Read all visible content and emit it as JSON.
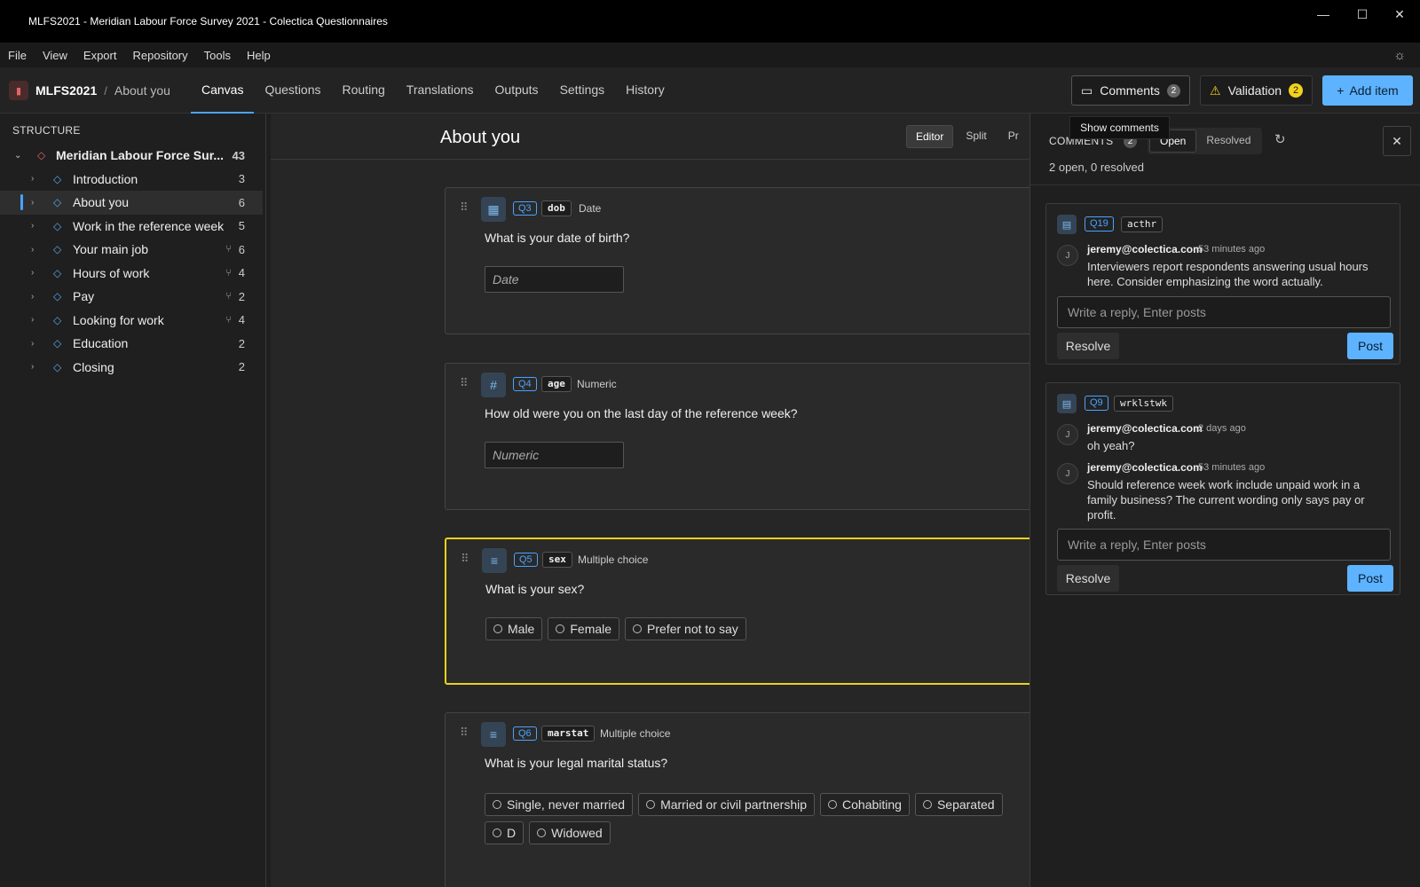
{
  "window": {
    "title": "MLFS2021 - Meridian Labour Force Survey 2021 - Colectica Questionnaires",
    "controls": {
      "minimize": "—",
      "maximize": "☐",
      "close": "✕"
    }
  },
  "menu": [
    "File",
    "View",
    "Export",
    "Repository",
    "Tools",
    "Help"
  ],
  "toolbar": {
    "project": "MLFS2021",
    "separator": "/",
    "page": "About you",
    "tabs": [
      "Canvas",
      "Questions",
      "Routing",
      "Translations",
      "Outputs",
      "Settings",
      "History"
    ],
    "active_tab": "Canvas",
    "comments_label": "Comments",
    "comments_count": "2",
    "validation_label": "Validation",
    "validation_count": "2",
    "add_item_label": "Add item",
    "tooltip": "Show comments"
  },
  "sidebar": {
    "heading": "STRUCTURE",
    "root": {
      "label": "Meridian Labour Force Sur...",
      "count": "43"
    },
    "items": [
      {
        "label": "Introduction",
        "count": "3",
        "branch": false
      },
      {
        "label": "About you",
        "count": "6",
        "branch": false,
        "selected": true
      },
      {
        "label": "Work in the reference week",
        "count": "5",
        "branch": false
      },
      {
        "label": "Your main job",
        "count": "6",
        "branch": true
      },
      {
        "label": "Hours of work",
        "count": "4",
        "branch": true
      },
      {
        "label": "Pay",
        "count": "2",
        "branch": true
      },
      {
        "label": "Looking for work",
        "count": "4",
        "branch": true
      },
      {
        "label": "Education",
        "count": "2",
        "branch": false
      },
      {
        "label": "Closing",
        "count": "2",
        "branch": false
      }
    ]
  },
  "main": {
    "title": "About you",
    "view_modes": [
      "Editor",
      "Split",
      "Pr"
    ],
    "active_view": "Editor",
    "questions": [
      {
        "id": "Q3",
        "var": "dob",
        "type": "Date",
        "icon": "calendar-icon",
        "text": "What is your date of birth?",
        "input_placeholder": "Date"
      },
      {
        "id": "Q4",
        "var": "age",
        "type": "Numeric",
        "icon": "hash-icon",
        "text": "How old were you on the last day of the reference week?",
        "input_placeholder": "Numeric"
      },
      {
        "id": "Q5",
        "var": "sex",
        "type": "Multiple choice",
        "icon": "list-icon",
        "text": "What is your sex?",
        "options": [
          "Male",
          "Female",
          "Prefer not to say"
        ],
        "highlighted": true
      },
      {
        "id": "Q6",
        "var": "marstat",
        "type": "Multiple choice",
        "icon": "list-icon",
        "text": "What is your legal marital status?",
        "options": [
          "Single, never married",
          "Married or civil partnership",
          "Cohabiting",
          "Separated",
          "D",
          "Widowed"
        ]
      }
    ]
  },
  "comments": {
    "heading": "COMMENTS",
    "heading_count": "2",
    "filters": [
      "Open",
      "Resolved"
    ],
    "active_filter": "Open",
    "summary": "2 open, 0 resolved",
    "reply_placeholder": "Write a reply, Enter posts",
    "resolve_label": "Resolve",
    "post_label": "Post",
    "threads": [
      {
        "qid": "Q19",
        "var": "acthr",
        "messages": [
          {
            "avatar": "J",
            "author": "jeremy@colectica.com",
            "time": "53 minutes ago",
            "body": "Interviewers report respondents answering usual hours here. Consider emphasizing the word actually."
          }
        ]
      },
      {
        "qid": "Q9",
        "var": "wrklstwk",
        "messages": [
          {
            "avatar": "J",
            "author": "jeremy@colectica.com",
            "time": "2 days ago",
            "body": "oh yeah?"
          },
          {
            "avatar": "J",
            "author": "jeremy@colectica.com",
            "time": "53 minutes ago",
            "body": "Should reference week work include unpaid work in a family business? The current wording only says pay or profit."
          }
        ]
      }
    ]
  },
  "colors": {
    "accent": "#4aa3ff",
    "primary_button": "#5db3ff",
    "highlight": "#e8d21c",
    "warning": "#f2d21c"
  }
}
